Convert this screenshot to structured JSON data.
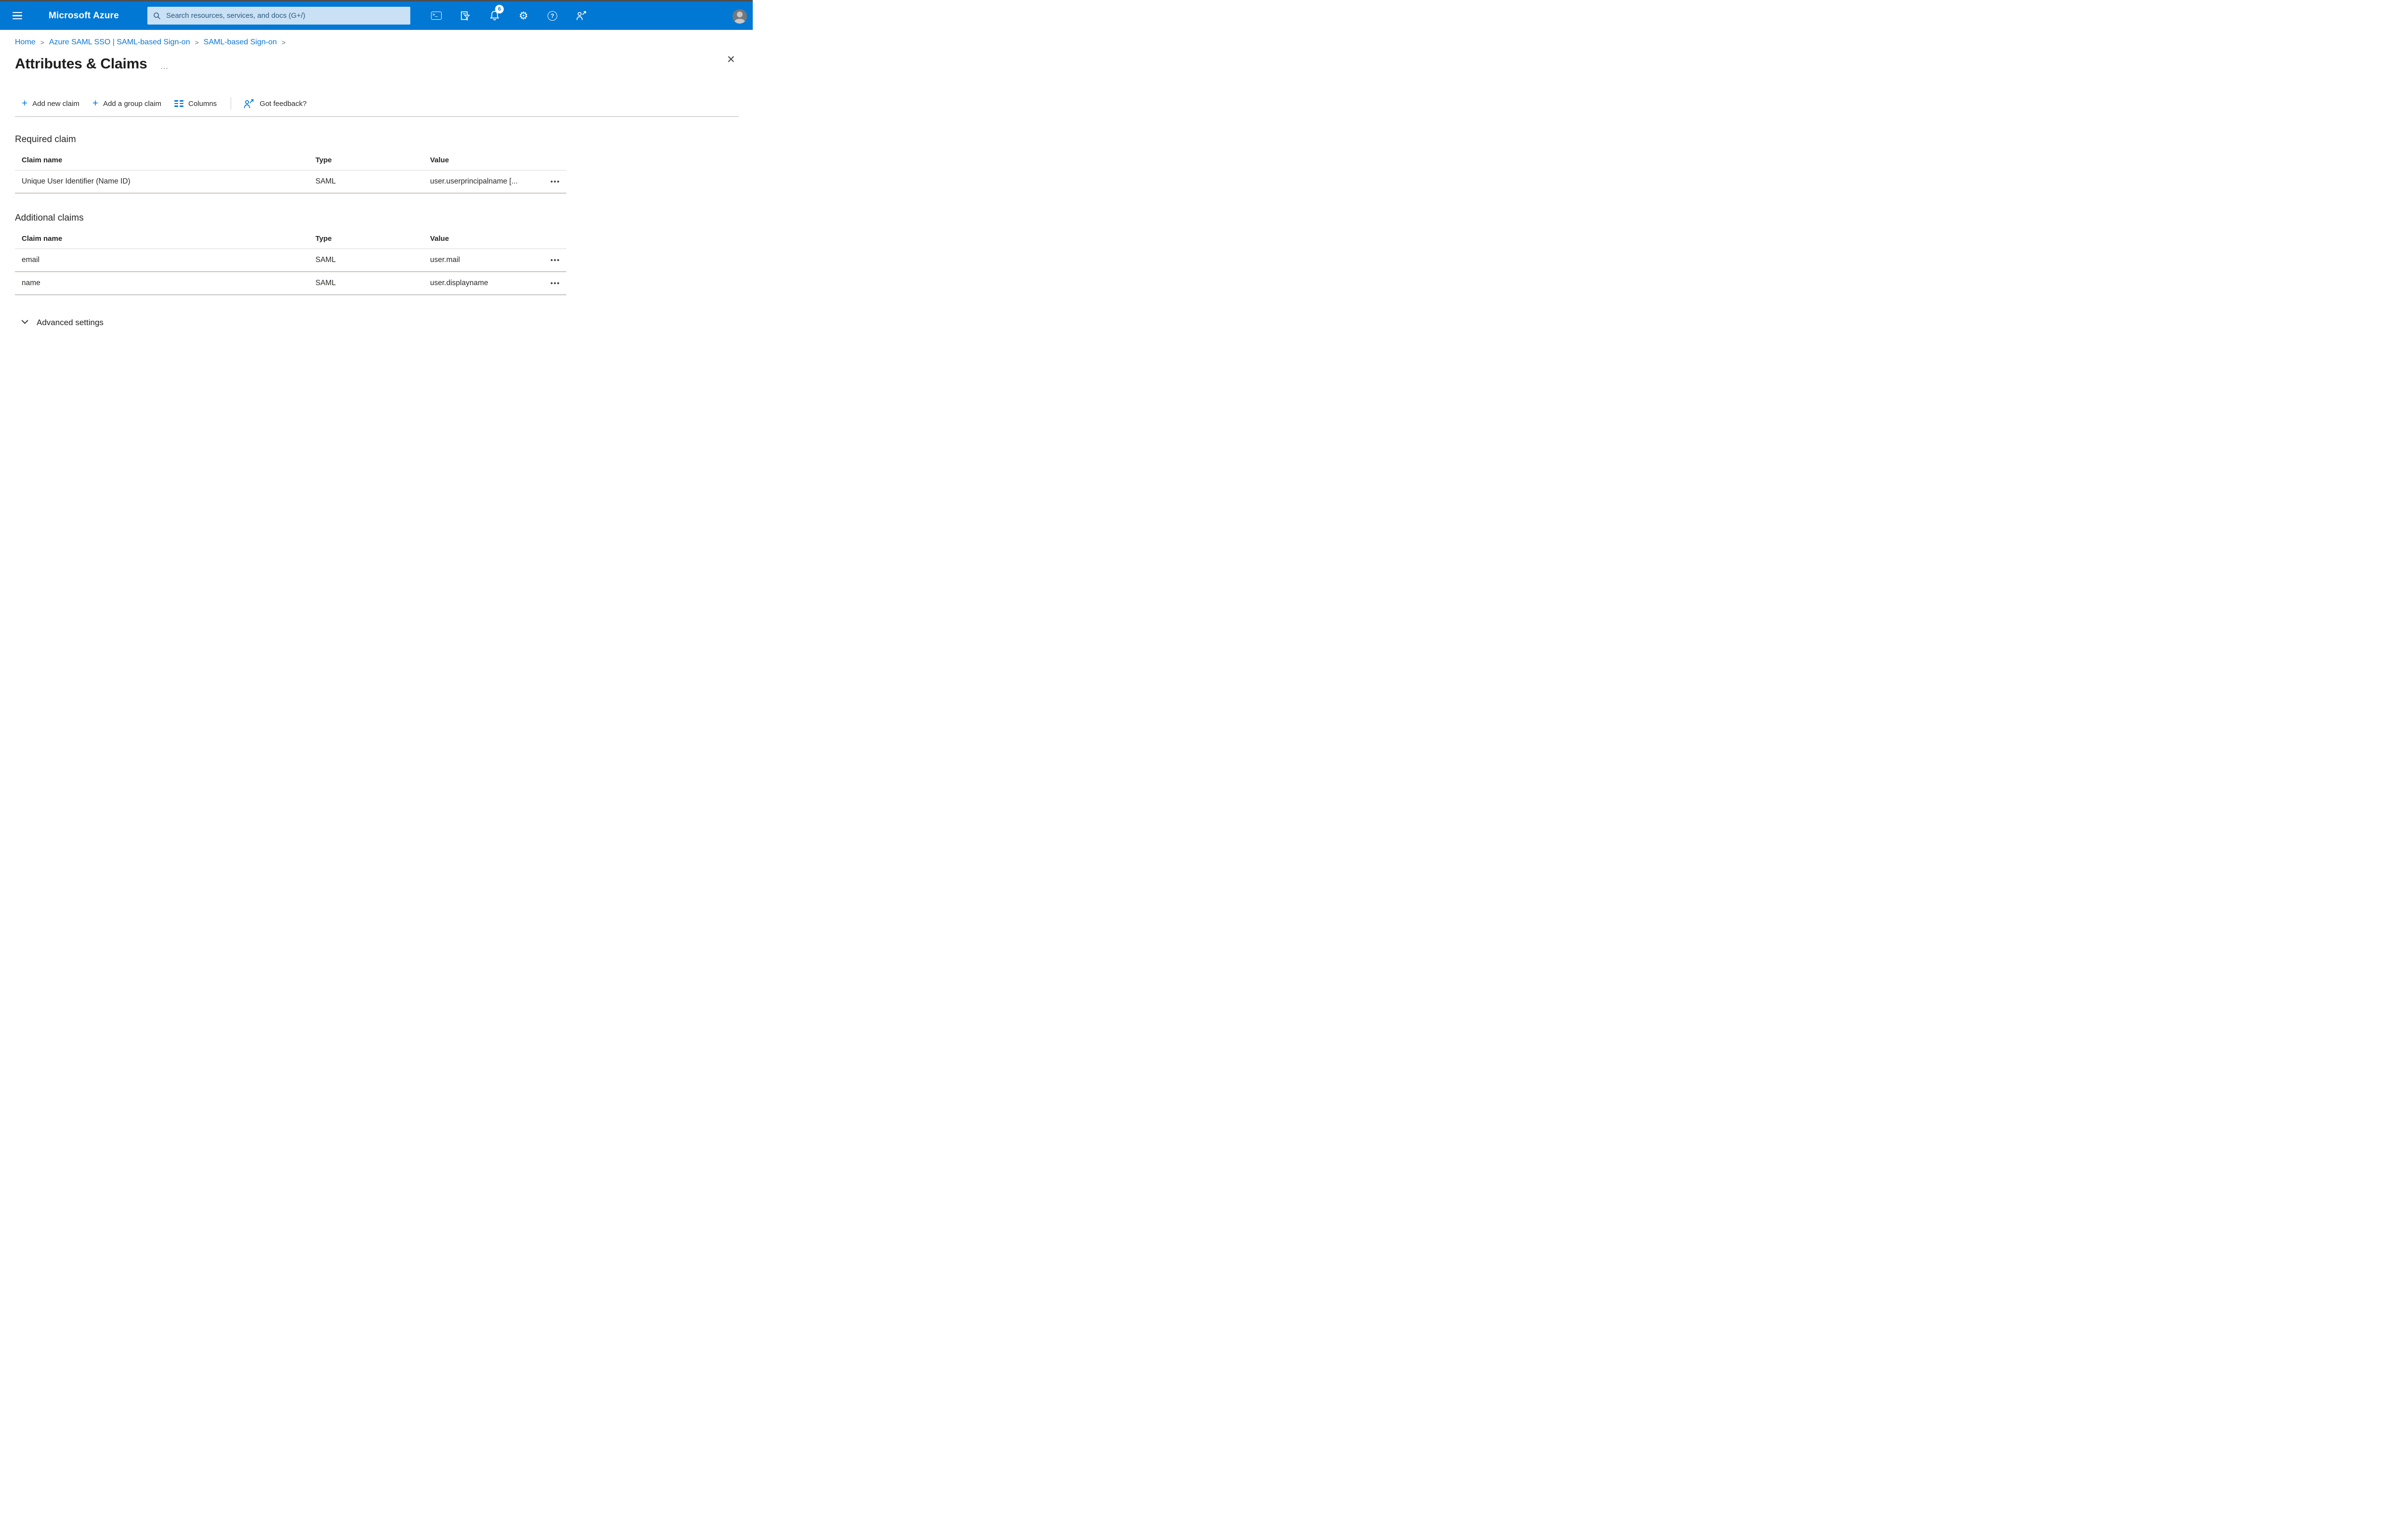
{
  "colors": {
    "accent": "#0078d4",
    "topbar_bg": "#0078d4",
    "search_bg": "#c9e0f5",
    "search_text": "#2b5a7f",
    "link": "#0a77d4",
    "badge_bg": "#ffffff",
    "badge_text": "#0078d4"
  },
  "topbar": {
    "brand": "Microsoft Azure",
    "search": {
      "placeholder": "Search resources, services, and docs (G+/)",
      "icon": "magnifier-icon"
    },
    "buttons": [
      {
        "name": "cloud-shell",
        "icon": "terminal-icon"
      },
      {
        "name": "directory-filter",
        "icon": "filter-icon"
      },
      {
        "name": "notifications",
        "icon": "bell-icon",
        "badge": "6"
      },
      {
        "name": "settings",
        "icon": "gear-icon"
      },
      {
        "name": "help",
        "icon": "question-icon"
      },
      {
        "name": "feedback",
        "icon": "person-feedback-icon"
      }
    ],
    "avatar_icon": "avatar"
  },
  "glyphs": {
    "terminal": ">_",
    "question": "?",
    "gear": "⚙",
    "plus": "+",
    "title_overflow": "…",
    "close": "×",
    "row_menu": "•••"
  },
  "breadcrumb": {
    "separator": ">",
    "items": [
      {
        "label": "Home"
      },
      {
        "label": "Azure SAML SSO | SAML-based Sign-on"
      },
      {
        "label": "SAML-based Sign-on"
      }
    ]
  },
  "page": {
    "title": "Attributes & Claims"
  },
  "toolbar": {
    "items": [
      {
        "label": "Add new claim",
        "icon": "plus-icon"
      },
      {
        "label": "Add a group claim",
        "icon": "plus-icon"
      },
      {
        "label": "Columns",
        "icon": "columns-icon"
      },
      {
        "label": "Got feedback?",
        "icon": "person-feedback-icon"
      }
    ]
  },
  "required_claim": {
    "heading": "Required claim",
    "columns": [
      "Claim name",
      "Type",
      "Value"
    ],
    "rows": [
      {
        "claim_name": "Unique User Identifier (Name ID)",
        "type": "SAML",
        "value": "user.userprincipalname [..."
      }
    ]
  },
  "additional_claims": {
    "heading": "Additional claims",
    "columns": [
      "Claim name",
      "Type",
      "Value"
    ],
    "rows": [
      {
        "claim_name": "email",
        "type": "SAML",
        "value": "user.mail"
      },
      {
        "claim_name": "name",
        "type": "SAML",
        "value": "user.displayname"
      }
    ]
  },
  "advanced": {
    "label": "Advanced settings",
    "icon": "chevron-down-icon"
  }
}
